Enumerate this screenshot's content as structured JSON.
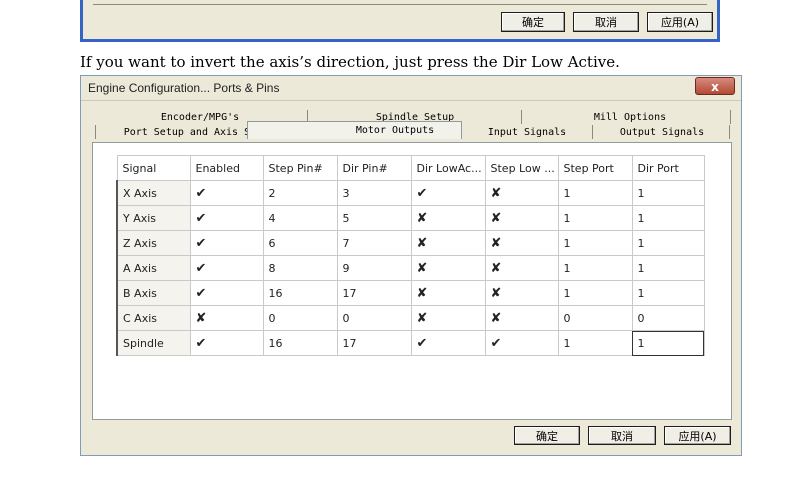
{
  "top_dialog": {
    "buttons": [
      "确定",
      "取消",
      "应用(A)"
    ]
  },
  "caption": "If you want to invert the axis’s direction, just press the Dir Low Active.",
  "dialog": {
    "title": "Engine Configuration... Ports & Pins",
    "close_glyph": "x",
    "tabs_row1": [
      "Encoder/MPG's",
      "Spindle Setup",
      "Mill Options"
    ],
    "tabs_row2": [
      "Port Setup and Axis Selection",
      "Motor Outputs",
      "Input Signals",
      "Output Signals"
    ],
    "active_tab": "Motor Outputs",
    "table": {
      "columns": [
        "Signal",
        "Enabled",
        "Step Pin#",
        "Dir Pin#",
        "Dir LowAc...",
        "Step Low ...",
        "Step Port",
        "Dir Port"
      ],
      "rows": [
        {
          "signal": "X Axis",
          "enabled": "✔",
          "step_pin": "2",
          "dir_pin": "3",
          "dir_low": "✔",
          "step_low": "✘",
          "step_port": "1",
          "dir_port": "1"
        },
        {
          "signal": "Y Axis",
          "enabled": "✔",
          "step_pin": "4",
          "dir_pin": "5",
          "dir_low": "✘",
          "step_low": "✘",
          "step_port": "1",
          "dir_port": "1"
        },
        {
          "signal": "Z Axis",
          "enabled": "✔",
          "step_pin": "6",
          "dir_pin": "7",
          "dir_low": "✘",
          "step_low": "✘",
          "step_port": "1",
          "dir_port": "1"
        },
        {
          "signal": "A Axis",
          "enabled": "✔",
          "step_pin": "8",
          "dir_pin": "9",
          "dir_low": "✘",
          "step_low": "✘",
          "step_port": "1",
          "dir_port": "1"
        },
        {
          "signal": "B Axis",
          "enabled": "✔",
          "step_pin": "16",
          "dir_pin": "17",
          "dir_low": "✘",
          "step_low": "✘",
          "step_port": "1",
          "dir_port": "1"
        },
        {
          "signal": "C Axis",
          "enabled": "✘",
          "step_pin": "0",
          "dir_pin": "0",
          "dir_low": "✘",
          "step_low": "✘",
          "step_port": "0",
          "dir_port": "0"
        },
        {
          "signal": "Spindle",
          "enabled": "✔",
          "step_pin": "16",
          "dir_pin": "17",
          "dir_low": "✔",
          "step_low": "✔",
          "step_port": "1",
          "dir_port": "1"
        }
      ]
    },
    "buttons": {
      "ok": "确定",
      "cancel": "取消",
      "apply": "应用(A)"
    }
  },
  "colors": {
    "enabled_mark": "#1a9e1a",
    "disabled_mark": "#c81c1c",
    "title_border": "#3763c6"
  }
}
